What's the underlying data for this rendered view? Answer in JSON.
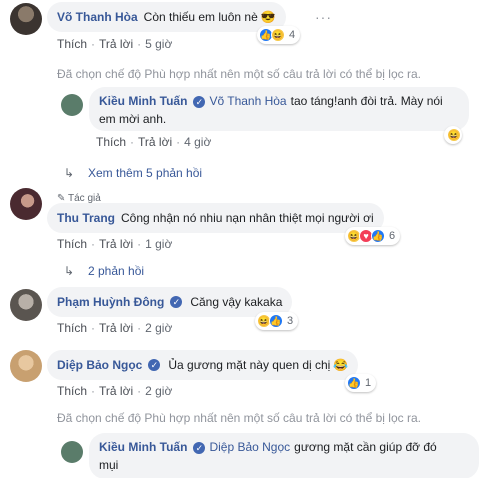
{
  "colors": {
    "link": "#385898",
    "bubble": "#f2f3f5",
    "meta": "#616770",
    "like": "#2078f4"
  },
  "c1": {
    "author": "Võ Thanh Hòa",
    "text": "Còn thiếu em luôn nè",
    "emoji": "😎",
    "like": "Thích",
    "reply": "Trả lời",
    "time": "5 giờ",
    "react_count": "4"
  },
  "filter1": "Đã chọn chế độ Phù hợp nhất nên một số câu trả lời có thể bị lọc ra.",
  "r1": {
    "author": "Kiều Minh Tuấn",
    "tag": "Võ Thanh Hòa",
    "text_line1": "tao táng!anh đòi trả. Mày nói",
    "text_line2": "em mời anh.",
    "like": "Thích",
    "reply": "Trả lời",
    "time": "4 giờ",
    "react_count": ""
  },
  "more1": "Xem thêm 5 phản hồi",
  "c2": {
    "author_badge": "Tác giả",
    "author": "Thu Trang",
    "text": "Công nhận nó nhiu nạn nhân thiệt mọi người ơi",
    "like": "Thích",
    "reply": "Trả lời",
    "time": "1 giờ",
    "react_count": "6"
  },
  "more2": "2 phản hồi",
  "c3": {
    "author": "Phạm Huỳnh Đông",
    "text": "Căng vậy kakaka",
    "like": "Thích",
    "reply": "Trả lời",
    "time": "2 giờ",
    "react_count": "3"
  },
  "c4": {
    "author": "Diệp Bảo Ngọc",
    "text": "Ủa gương mặt này quen dị chị",
    "emoji": "😂",
    "like": "Thích",
    "reply": "Trả lời",
    "time": "2 giờ",
    "react_count": "1"
  },
  "filter2": "Đã chọn chế độ Phù hợp nhất nên một số câu trả lời có thể bị lọc ra.",
  "r2": {
    "author": "Kiều Minh Tuấn",
    "tag": "Diệp Bảo Ngọc",
    "text_line1": "gương mặt cần giúp đỡ đó",
    "text_line2": "mụi"
  },
  "icons": {
    "more": "more-dots-icon",
    "verified": "verified-icon",
    "reply_arrow": "reply-arrow-icon",
    "pen": "pen-icon"
  }
}
